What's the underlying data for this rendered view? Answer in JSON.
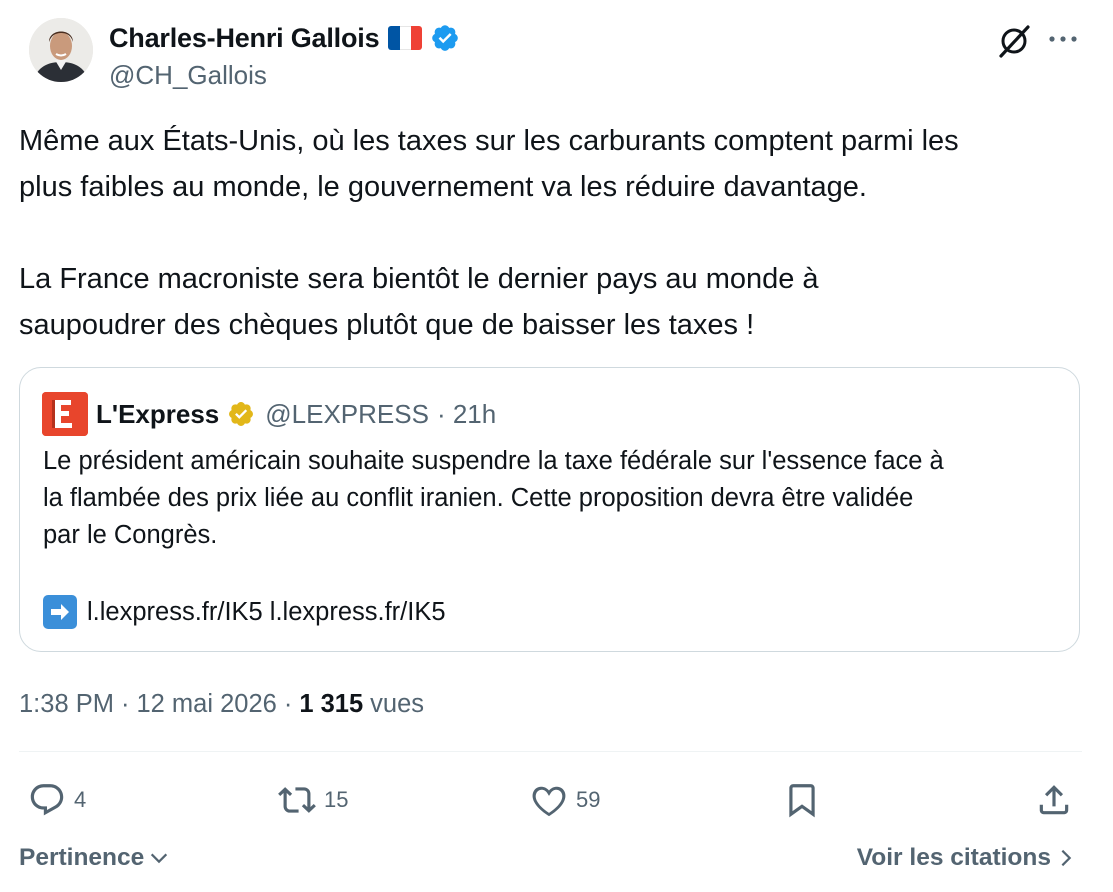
{
  "tweet": {
    "author_name": "Charles-Henri Gallois",
    "handle": "@CH_Gallois",
    "text": "Même aux États-Unis, où les taxes sur les carburants comptent parmi les\nplus faibles au monde, le gouvernement va les réduire davantage.\n\nLa France macroniste sera bientôt le dernier pays au monde à\nsaupoudrer des chèques plutôt que de baisser les taxes !",
    "flag_colors": [
      "#0055a4",
      "#ffffff",
      "#ef4135"
    ],
    "verified_color": "#1d9bf0"
  },
  "quote": {
    "name": "L'Express",
    "handle": "@LEXPRESS",
    "time": "· 21h",
    "logo_letter": "E",
    "badge_color": "#e2b719",
    "text": "Le président américain souhaite suspendre la taxe fédérale sur l'essence face à\nla flambée des prix liée au conflit iranien. Cette proposition devra être validée\npar le Congrès.",
    "link_emoji": "➡",
    "link_text": "l.lexpress.fr/IK5 l.lexpress.fr/IK5"
  },
  "meta": {
    "time": "1:38 PM",
    "date": "12 mai 2026",
    "views_count": "1 315",
    "views_label": "vues"
  },
  "actions": {
    "replies": "4",
    "reposts": "15",
    "likes": "59"
  },
  "footer": {
    "sort_label": "Pertinence",
    "quotes_label": "Voir les citations"
  }
}
